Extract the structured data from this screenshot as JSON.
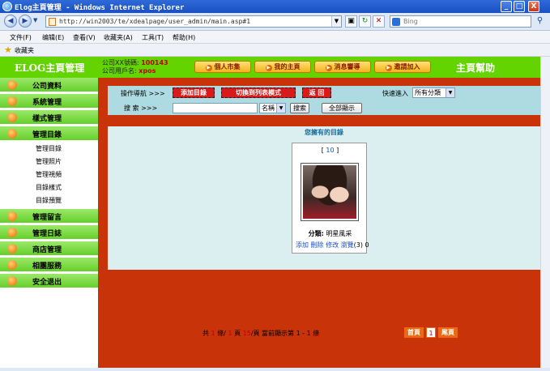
{
  "window": {
    "title": "Elog主頁管理 - Windows Internet Explorer",
    "minimize": "_",
    "maximize": "□",
    "close": "X"
  },
  "address": {
    "url": "http://win2003/te/xdealpage/user_admin/main.asp#1",
    "search_placeholder": "Bing"
  },
  "menu": [
    "文件(F)",
    "编辑(E)",
    "查看(V)",
    "收藏夹(A)",
    "工具(T)",
    "帮助(H)"
  ],
  "favorites": {
    "label": "收藏夹"
  },
  "header": {
    "brand": "ELOG主頁管理",
    "company_id_label": "公司XX號碼:",
    "company_id": "100143",
    "company_user_label": "公司用戶名:",
    "company_user": "xpos",
    "nav": [
      "個人市集",
      "我的主頁",
      "消息響導",
      "邀請加入"
    ],
    "help_title": "主頁幫助"
  },
  "sidebar": {
    "sections": [
      {
        "label": "公司資料",
        "subs": []
      },
      {
        "label": "系統管理",
        "subs": []
      },
      {
        "label": "樣式管理",
        "subs": []
      },
      {
        "label": "管理目錄",
        "subs": [
          "管理目錄",
          "管理照片",
          "管理視頻",
          "目錄樣式",
          "目錄預覽"
        ]
      },
      {
        "label": "管理留言",
        "subs": []
      },
      {
        "label": "管理日誌",
        "subs": []
      },
      {
        "label": "商店管理",
        "subs": []
      },
      {
        "label": "相團服務",
        "subs": []
      },
      {
        "label": "安全退出",
        "subs": []
      }
    ]
  },
  "toolbar": {
    "nav_label": "操作導航 >>>",
    "add_dir": "添加目錄",
    "switch_list": "切換到列表模式",
    "back": "返 回",
    "quick_label": "快速進入",
    "quick_select": "所有分類",
    "search_label": "搜 索 >>>",
    "search_value": "",
    "field_select": "名稱",
    "search_btn": "搜索",
    "show_all_btn": "全部顯示"
  },
  "panel": {
    "title": "您擁有的目錄",
    "card": {
      "count_open": "[",
      "count": "10",
      "count_close": "]",
      "category_label": "分類:",
      "category": "明星風采",
      "ops": [
        "添加",
        "刪除",
        "修改",
        "瀏覽"
      ],
      "views_a": "(3)",
      "views_b": "0"
    }
  },
  "pager": {
    "prefix": "共",
    "total": "1",
    "items_unit": "條/",
    "pages": "1",
    "pages_unit": "頁",
    "per_page": "15",
    "per_page_unit": "/頁 當前顯示第 1 - 1 條",
    "first": "首頁",
    "current": "1",
    "last": "尾頁"
  },
  "colors": {
    "header_green": "#63d400",
    "main_red": "#c8330a",
    "toolbar_blue": "#aedbe1",
    "panel_bg": "#dbeef0",
    "button_red": "#d81a1a",
    "pager_orange": "#e86a12"
  }
}
